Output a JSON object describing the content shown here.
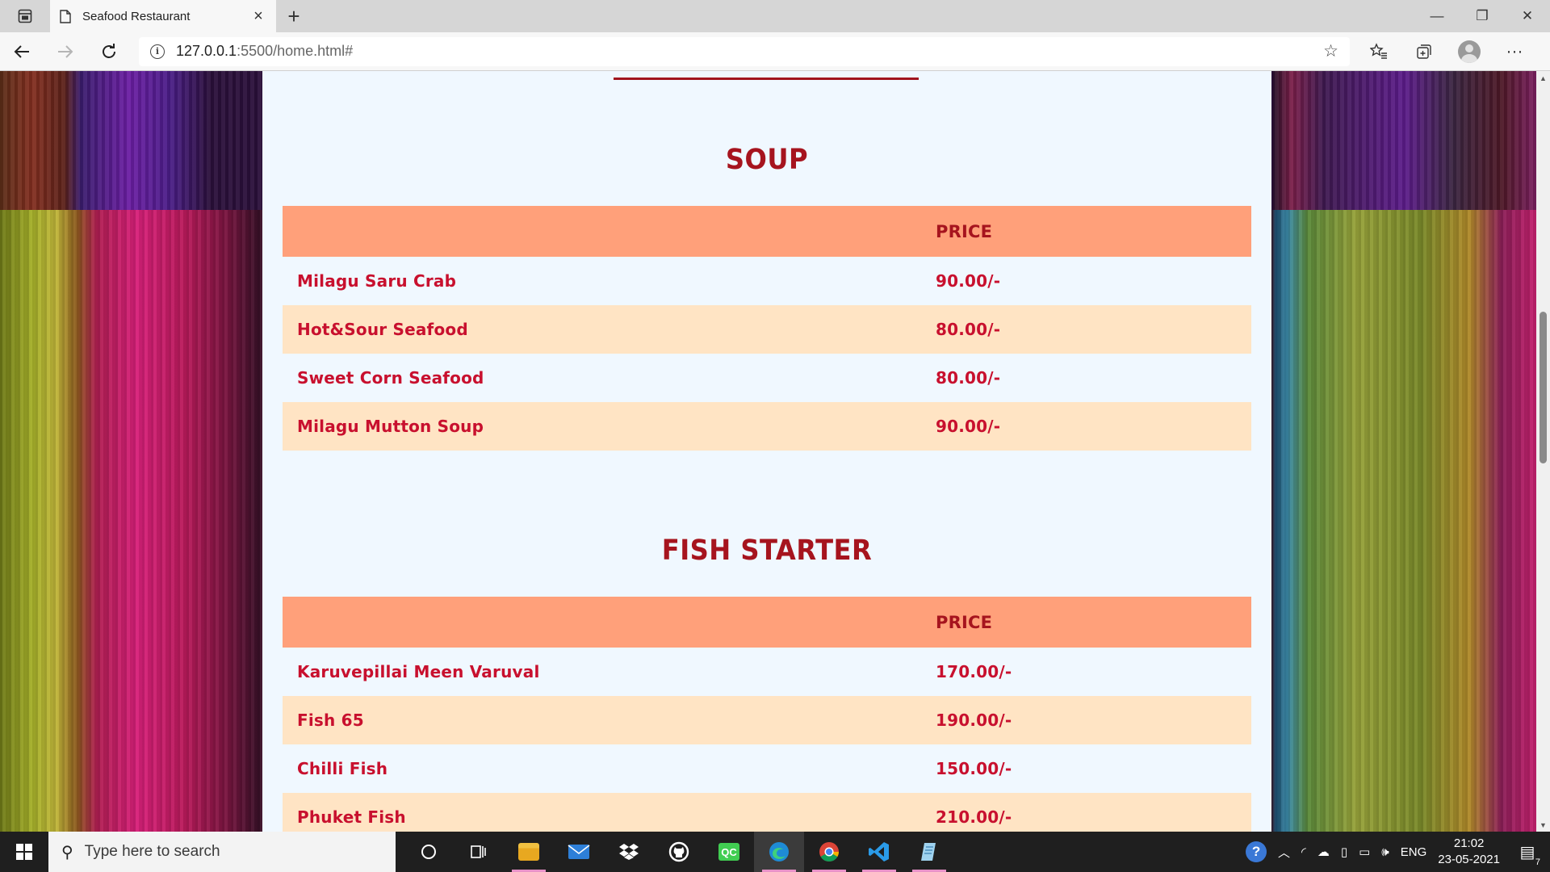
{
  "browser": {
    "tab_title": "Seafood Restaurant",
    "tab_close": "×",
    "new_tab": "+",
    "url_host": "127.0.0.1",
    "url_rest": ":5500/home.html#",
    "win_minimize": "—",
    "win_restore": "❐",
    "win_close": "✕"
  },
  "menu": {
    "sections": [
      {
        "title": "SOUP",
        "price_header": "PRICE",
        "items": [
          {
            "name": "Milagu Saru Crab",
            "price": "90.00/-"
          },
          {
            "name": "Hot&Sour Seafood",
            "price": "80.00/-"
          },
          {
            "name": "Sweet Corn Seafood",
            "price": "80.00/-"
          },
          {
            "name": "Milagu Mutton Soup",
            "price": "90.00/-"
          }
        ]
      },
      {
        "title": "FISH STARTER",
        "price_header": "PRICE",
        "items": [
          {
            "name": "Karuvepillai Meen Varuval",
            "price": "170.00/-"
          },
          {
            "name": "Fish 65",
            "price": "190.00/-"
          },
          {
            "name": "Chilli Fish",
            "price": "150.00/-"
          },
          {
            "name": "Phuket Fish",
            "price": "210.00/-"
          }
        ]
      }
    ]
  },
  "colors": {
    "heading": "#a6141e",
    "item_text": "#c8102e",
    "header_row": "#ffa07a",
    "alt_row": "#ffe4c4",
    "content_bg": "#f0f8ff"
  },
  "taskbar": {
    "search_placeholder": "Type here to search",
    "language": "ENG",
    "time": "21:02",
    "date": "23-05-2021",
    "notification_count": "7"
  }
}
